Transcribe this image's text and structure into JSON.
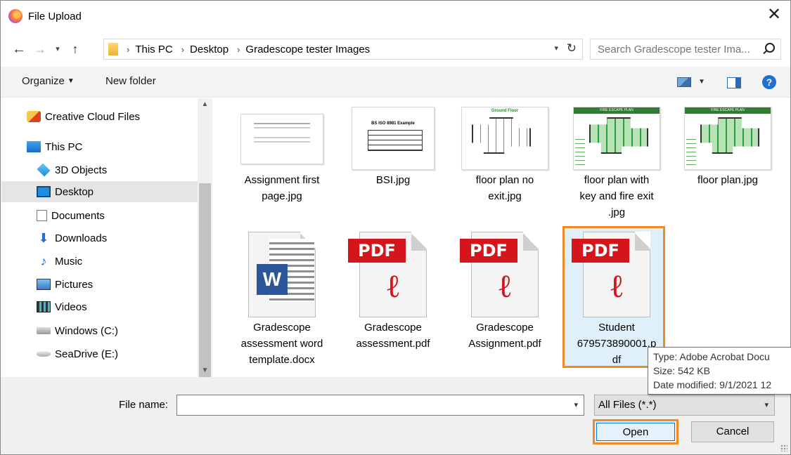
{
  "window": {
    "title": "File Upload",
    "app_icon": "firefox-icon",
    "close_label": "✕"
  },
  "nav": {
    "back": "←",
    "forward": "→",
    "recent": "⌄",
    "up": "↑",
    "breadcrumbs": [
      "This PC",
      "Desktop",
      "Gradescope tester Images"
    ],
    "separator": "›",
    "refresh": "↻",
    "search_placeholder": "Search Gradescope tester Ima..."
  },
  "toolbar": {
    "organize": "Organize",
    "new_folder": "New folder",
    "help": "?"
  },
  "sidebar": {
    "items": [
      {
        "label": "Creative Cloud Files",
        "icon": "creative-cloud-icon"
      },
      {
        "label": "This PC",
        "icon": "computer-icon"
      },
      {
        "label": "3D Objects",
        "icon": "3d-objects-icon"
      },
      {
        "label": "Desktop",
        "icon": "desktop-icon",
        "selected": true
      },
      {
        "label": "Documents",
        "icon": "documents-icon"
      },
      {
        "label": "Downloads",
        "icon": "downloads-icon"
      },
      {
        "label": "Music",
        "icon": "music-icon"
      },
      {
        "label": "Pictures",
        "icon": "pictures-icon"
      },
      {
        "label": "Videos",
        "icon": "videos-icon"
      },
      {
        "label": "Windows (C:)",
        "icon": "drive-c-icon"
      },
      {
        "label": "SeaDrive (E:)",
        "icon": "drive-e-icon"
      }
    ]
  },
  "files": [
    {
      "name_lines": [
        "Assignment first",
        "page.jpg"
      ],
      "kind": "jpg-doc"
    },
    {
      "name_lines": [
        "BSI.jpg"
      ],
      "kind": "jpg-table",
      "thumb_title": "BS ISO 8981 Example"
    },
    {
      "name_lines": [
        "floor plan no",
        "exit.jpg"
      ],
      "kind": "jpg-plan",
      "thumb_title": "Ground Floor"
    },
    {
      "name_lines": [
        "floor plan with",
        "key and fire exit",
        ".jpg"
      ],
      "kind": "jpg-fire",
      "thumb_title": "FIRE ESCAPE PLAN"
    },
    {
      "name_lines": [
        "floor plan.jpg"
      ],
      "kind": "jpg-fire",
      "thumb_title": "FIRE ESCAPE PLAN"
    },
    {
      "name_lines": [
        "Gradescope",
        "assessment word",
        "template.docx"
      ],
      "kind": "docx",
      "badge": "W"
    },
    {
      "name_lines": [
        "Gradescope",
        "assessment.pdf"
      ],
      "kind": "pdf",
      "badge": "PDF"
    },
    {
      "name_lines": [
        "Gradescope",
        "Assignment.pdf"
      ],
      "kind": "pdf",
      "badge": "PDF"
    },
    {
      "name_lines": [
        "Student",
        "679573890001.p",
        "df"
      ],
      "kind": "pdf",
      "badge": "PDF",
      "selected": true
    }
  ],
  "tooltip": {
    "type": "Type: Adobe Acrobat Docu",
    "size": "Size: 542 KB",
    "modified": "Date modified: 9/1/2021 12"
  },
  "footer": {
    "file_name_label": "File name:",
    "file_name_value": "",
    "file_type": "All Files (*.*)",
    "open": "Open",
    "cancel": "Cancel"
  },
  "colors": {
    "highlight": "#f08a24",
    "selection": "#dff0fb",
    "pdf_red": "#d4151b",
    "word_blue": "#2b579a"
  }
}
